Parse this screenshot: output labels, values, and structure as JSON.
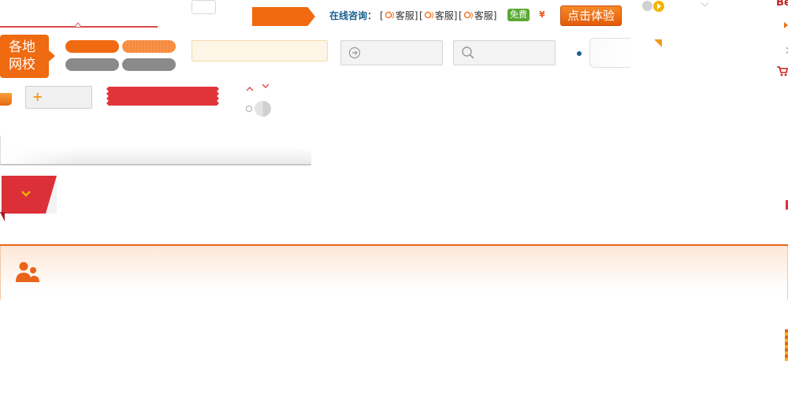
{
  "header": {
    "consult_label": "在线咨询：",
    "kefu_items": [
      {
        "label": "客服"
      },
      {
        "label": "客服"
      },
      {
        "label": "客服"
      }
    ],
    "bracket_open": "[",
    "bracket_close": "]",
    "free_badge": "免费",
    "yen_badge": "¥",
    "trial_button": "点击体验",
    "edge_text": "Be"
  },
  "school_tab": {
    "line1": "各地",
    "line2": "网校"
  },
  "plus_button": {
    "symbol": "+"
  },
  "colors": {
    "brand_orange": "#ef6a11",
    "accent_red": "#dc3038",
    "link_blue": "#1a5e8e",
    "free_green": "#5aa832",
    "neutral_grey": "#8a8a8a"
  },
  "icons": {
    "consult_icon": "qq-chat-icon",
    "go_icon": "arrow-circle-right-icon",
    "search_icon": "search-icon",
    "cart_icon": "shopping-cart-icon",
    "people_icon": "people-icon",
    "expand_icon": "chevron-down-icon"
  }
}
